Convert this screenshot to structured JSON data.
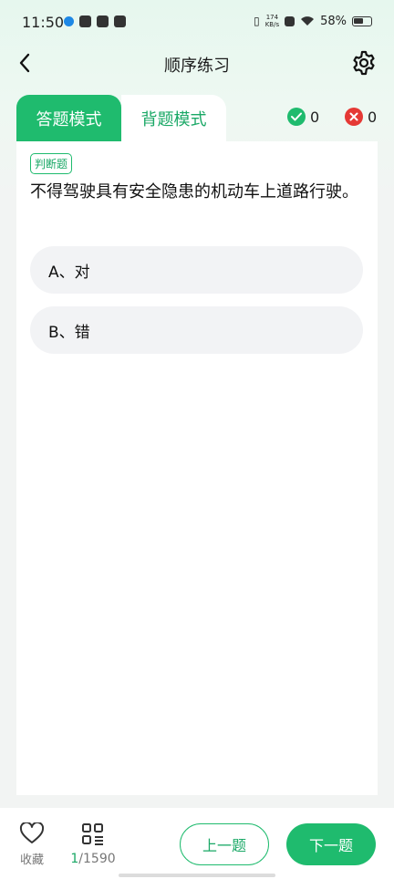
{
  "status_bar": {
    "time": "11:50",
    "net_speed_value": "174",
    "net_speed_unit": "KB/s",
    "battery": "58%"
  },
  "header": {
    "title": "顺序练习"
  },
  "modes": {
    "answer_mode": "答题模式",
    "memorize_mode": "背题模式"
  },
  "score": {
    "correct": "0",
    "wrong": "0"
  },
  "question": {
    "type": "判断题",
    "text": "不得驾驶具有安全隐患的机动车上道路行驶。",
    "options": [
      "A、对",
      "B、错"
    ]
  },
  "bottom_bar": {
    "favorite_label": "收藏",
    "current": "1",
    "total": "/1590",
    "prev_label": "上一题",
    "next_label": "下一题"
  },
  "colors": {
    "accent": "#1fbb6e",
    "correct": "#1fbb6e",
    "wrong": "#e53935"
  }
}
